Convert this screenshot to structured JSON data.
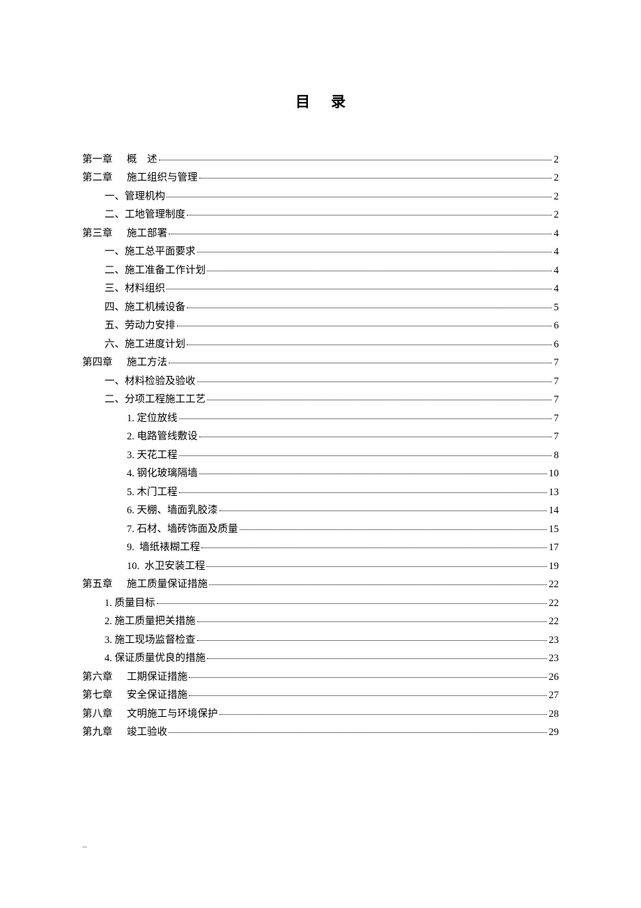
{
  "title": "目录",
  "footer": "–",
  "toc": [
    {
      "level": 1,
      "chapter": "第一章",
      "text": "概    述",
      "page": "2"
    },
    {
      "level": 1,
      "chapter": "第二章",
      "text": "施工组织与管理",
      "page": "2"
    },
    {
      "level": 2,
      "chapter": "",
      "text": "一、管理机构",
      "page": "2"
    },
    {
      "level": 2,
      "chapter": "",
      "text": "二、工地管理制度",
      "page": "2"
    },
    {
      "level": 1,
      "chapter": "第三章",
      "text": "施工部署",
      "page": "4"
    },
    {
      "level": 2,
      "chapter": "",
      "text": "一、施工总平面要求",
      "page": "4"
    },
    {
      "level": 2,
      "chapter": "",
      "text": "二、施工准备工作计划",
      "page": "4"
    },
    {
      "level": 2,
      "chapter": "",
      "text": "三、材料组织",
      "page": "4"
    },
    {
      "level": 2,
      "chapter": "",
      "text": "四、施工机械设备",
      "page": "5"
    },
    {
      "level": 2,
      "chapter": "",
      "text": "五、劳动力安排",
      "page": "6"
    },
    {
      "level": 2,
      "chapter": "",
      "text": "六、施工进度计划",
      "page": "6"
    },
    {
      "level": 1,
      "chapter": "第四章",
      "text": "施工方法",
      "page": "7"
    },
    {
      "level": 2,
      "chapter": "",
      "text": "一、材料检验及验收",
      "page": "7"
    },
    {
      "level": 2,
      "chapter": "",
      "text": "二、分项工程施工工艺",
      "page": "7"
    },
    {
      "level": 4,
      "chapter": "",
      "text": "1. 定位放线",
      "page": "7"
    },
    {
      "level": 4,
      "chapter": "",
      "text": "2. 电路管线敷设",
      "page": "7"
    },
    {
      "level": 4,
      "chapter": "",
      "text": "3. 天花工程",
      "page": "8"
    },
    {
      "level": 4,
      "chapter": "",
      "text": "4. 钢化玻璃隔墙",
      "page": "10"
    },
    {
      "level": 4,
      "chapter": "",
      "text": "5. 木门工程",
      "page": "13"
    },
    {
      "level": 4,
      "chapter": "",
      "text": "6. 天棚、墙面乳胶漆",
      "page": "14"
    },
    {
      "level": 4,
      "chapter": "",
      "text": "7. 石材、墙砖饰面及质量",
      "page": "15"
    },
    {
      "level": 4,
      "chapter": "",
      "text": "9.  墙纸裱糊工程",
      "page": "17"
    },
    {
      "level": 4,
      "chapter": "",
      "text": "10.  水卫安装工程",
      "page": "19"
    },
    {
      "level": 1,
      "chapter": "第五章",
      "text": "施工质量保证措施",
      "page": "22"
    },
    {
      "level": 3,
      "chapter": "",
      "text": "1. 质量目标",
      "page": "22"
    },
    {
      "level": 3,
      "chapter": "",
      "text": "2. 施工质量把关措施",
      "page": "22"
    },
    {
      "level": 3,
      "chapter": "",
      "text": "3. 施工现场监督检查",
      "page": "23"
    },
    {
      "level": 3,
      "chapter": "",
      "text": "4. 保证质量优良的措施",
      "page": "23"
    },
    {
      "level": 1,
      "chapter": "第六章",
      "text": "工期保证措施",
      "page": "26"
    },
    {
      "level": 1,
      "chapter": "第七章",
      "text": "安全保证措施",
      "page": "27"
    },
    {
      "level": 1,
      "chapter": "第八章",
      "text": "文明施工与环境保护",
      "page": "28"
    },
    {
      "level": 1,
      "chapter": "第九章",
      "text": "竣工验收",
      "page": "29"
    }
  ]
}
